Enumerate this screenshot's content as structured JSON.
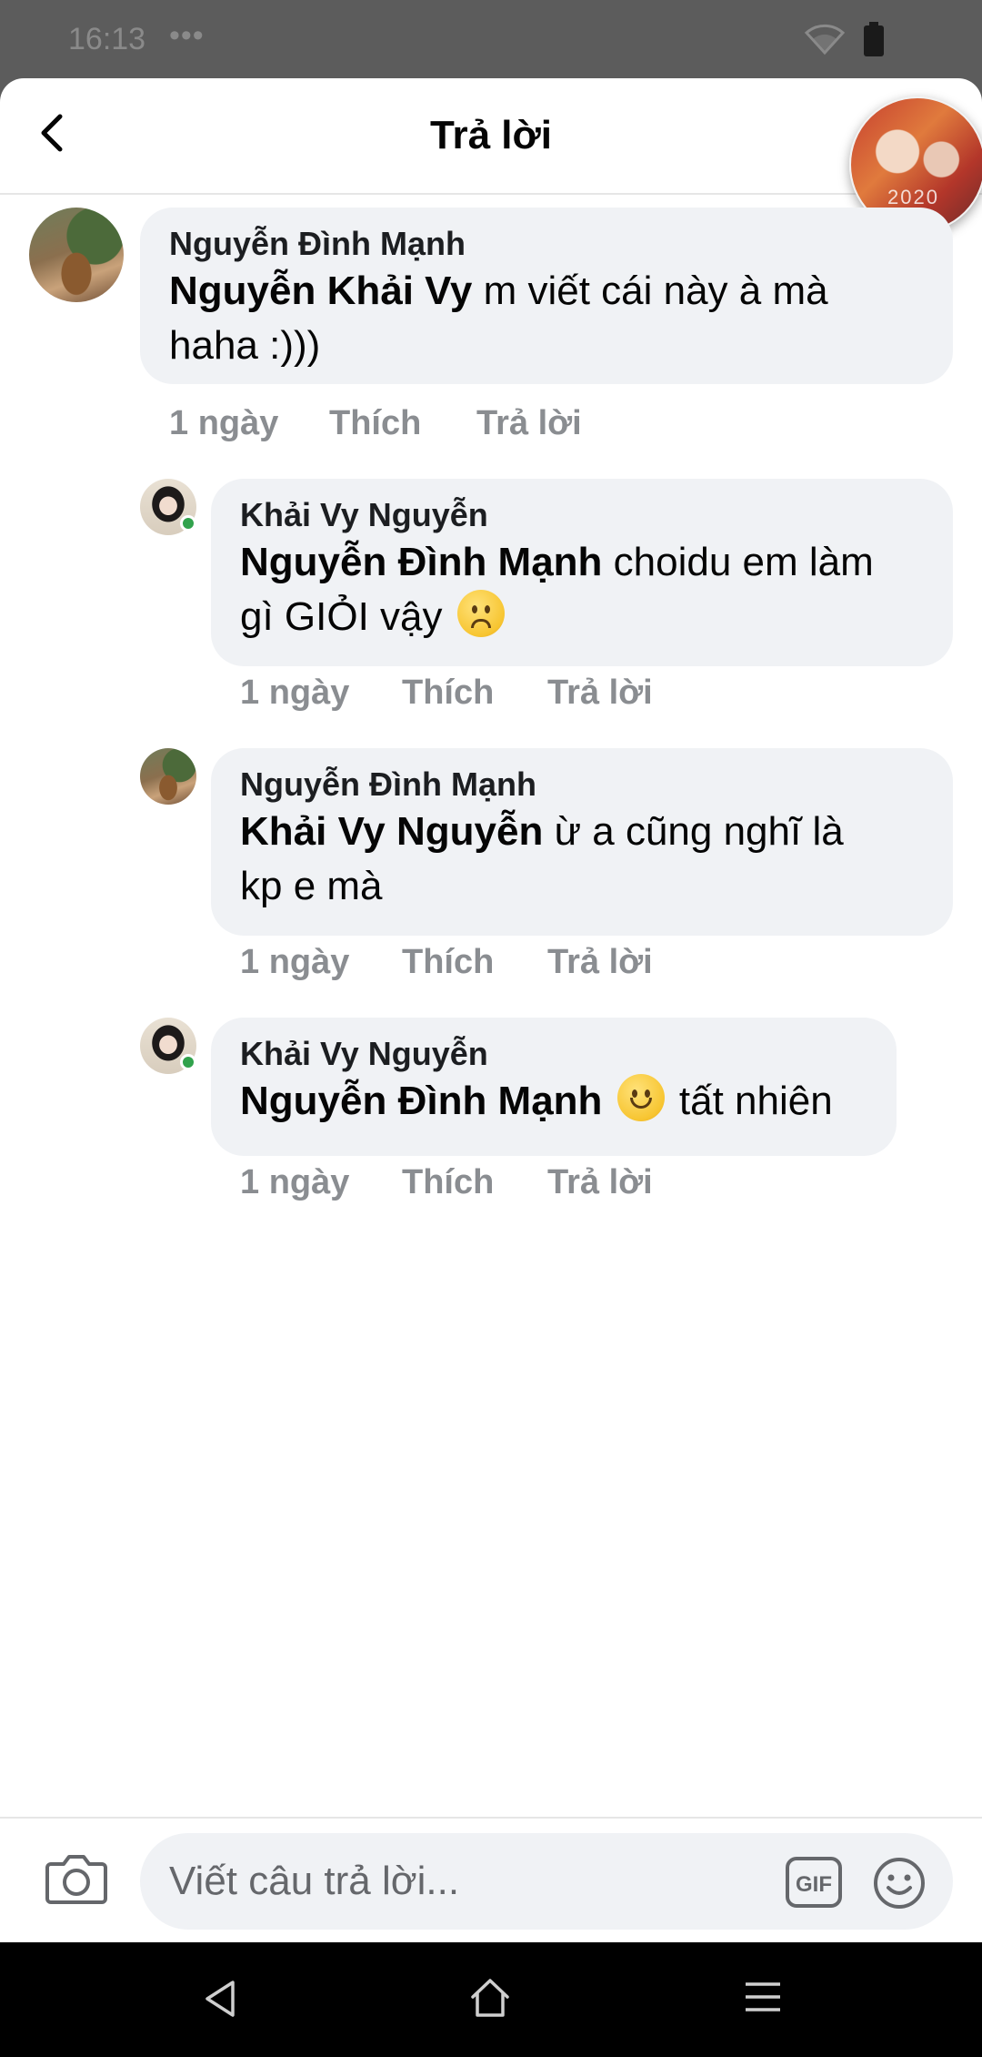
{
  "status_bar": {
    "time": "16:13",
    "dots": "•••"
  },
  "header": {
    "title": "Trả lời",
    "chat_head_text": "2020"
  },
  "comments": [
    {
      "author": "Nguyễn Đình Mạnh",
      "mention": "Nguyễn Khải Vy",
      "text_line1": " m viết cái này à mà",
      "text_line2": "haha :)))",
      "time": "1 ngày",
      "like": "Thích",
      "reply": "Trả lời",
      "online": false
    },
    {
      "author": "Khải Vy Nguyễn",
      "mention": "Nguyễn Đình Mạnh",
      "text_line1": " choidu em làm",
      "text_line2": "gì GIỎI vậy",
      "emoji": "frown-emoji",
      "time": "1 ngày",
      "like": "Thích",
      "reply": "Trả lời",
      "online": true
    },
    {
      "author": "Nguyễn Đình Mạnh",
      "mention": "Khải Vy Nguyễn",
      "text_line1": " ừ a cũng nghĩ là",
      "text_line2": "kp e mà",
      "time": "1 ngày",
      "like": "Thích",
      "reply": "Trả lời",
      "online": false
    },
    {
      "author": "Khải Vy Nguyễn",
      "mention": "Nguyễn Đình Mạnh",
      "emoji": "smile-emoji",
      "text_line1": "tất nhiên",
      "time": "1 ngày",
      "like": "Thích",
      "reply": "Trả lời",
      "online": true
    }
  ],
  "composer": {
    "placeholder": "Viết câu trả lời...",
    "camera_icon": "camera-icon",
    "gif_label": "GIF",
    "emoji_icon": "smiley-icon"
  },
  "colors": {
    "bubble": "#f0f2f5",
    "meta_text": "#8a8d91",
    "online": "#31a24c"
  }
}
